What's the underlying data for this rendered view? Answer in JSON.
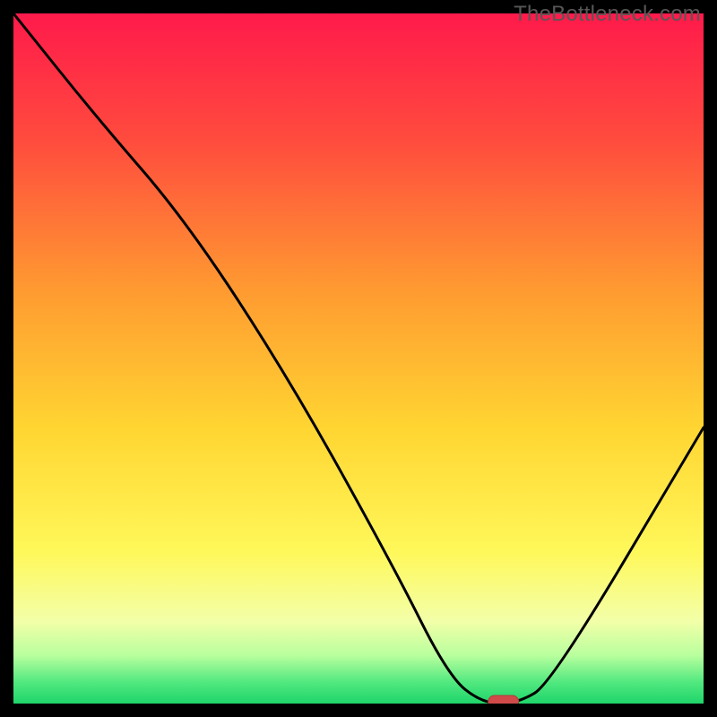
{
  "watermark": "TheBottleneck.com",
  "chart_data": {
    "type": "line",
    "title": "",
    "xlabel": "",
    "ylabel": "",
    "xlim": [
      0,
      100
    ],
    "ylim": [
      0,
      100
    ],
    "x": [
      0,
      12,
      25,
      40,
      55,
      63,
      68,
      73,
      78,
      100
    ],
    "values": [
      100,
      85,
      70,
      47,
      20,
      4,
      0,
      0,
      3,
      40
    ],
    "marker": {
      "x": 71,
      "y": 0
    },
    "gradient_stops": [
      {
        "offset": 0.0,
        "color": "#ff1a4b"
      },
      {
        "offset": 0.18,
        "color": "#ff4a3e"
      },
      {
        "offset": 0.4,
        "color": "#ff9a31"
      },
      {
        "offset": 0.6,
        "color": "#ffd531"
      },
      {
        "offset": 0.78,
        "color": "#fff85a"
      },
      {
        "offset": 0.88,
        "color": "#f3ffa8"
      },
      {
        "offset": 0.93,
        "color": "#b9ff9e"
      },
      {
        "offset": 0.97,
        "color": "#4fe87f"
      },
      {
        "offset": 1.0,
        "color": "#1fd56a"
      }
    ]
  }
}
